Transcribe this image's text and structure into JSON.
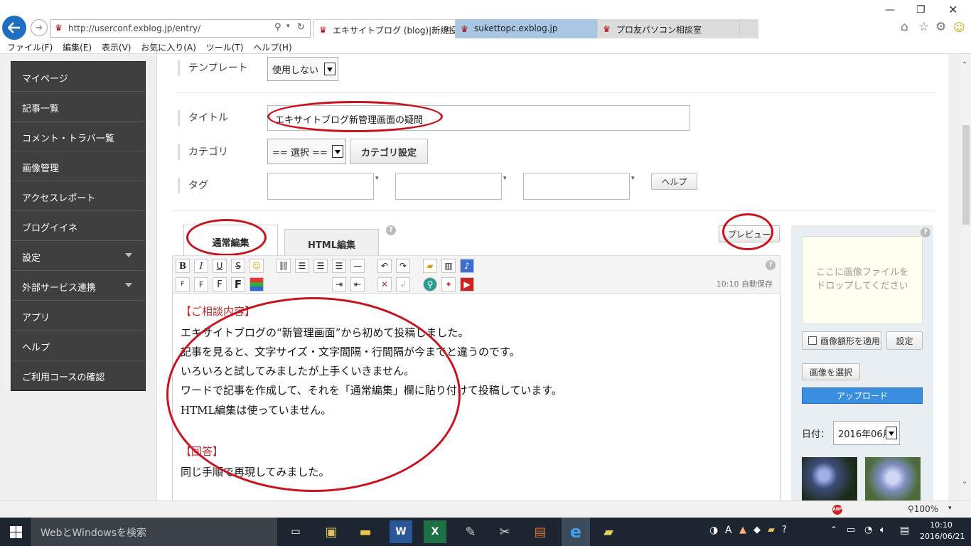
{
  "browser": {
    "url": "http://userconf.exblog.jp/entry/",
    "tabs": [
      {
        "label": "エキサイトブログ (blog)|新規投...",
        "active": true
      },
      {
        "label": "sukettopc.exblog.jp",
        "active": false
      },
      {
        "label": "プロ友パソコン相談室",
        "active": false
      }
    ],
    "tab_close": "×",
    "menu": [
      "ファイル(F)",
      "編集(E)",
      "表示(V)",
      "お気に入り(A)",
      "ツール(T)",
      "ヘルプ(H)"
    ],
    "zoom": "100%"
  },
  "sidebar": {
    "items": [
      {
        "label": "マイページ"
      },
      {
        "label": "記事一覧"
      },
      {
        "label": "コメント・トラバ一覧"
      },
      {
        "label": "画像管理"
      },
      {
        "label": "アクセスレポート"
      },
      {
        "label": "ブログイイネ"
      },
      {
        "label": "設定",
        "caret": true
      },
      {
        "label": "外部サービス連携",
        "caret": true
      },
      {
        "label": "アプリ"
      },
      {
        "label": "ヘルプ"
      },
      {
        "label": "ご利用コースの確認"
      }
    ]
  },
  "form": {
    "template_label": "テンプレート",
    "template_value": "使用しない",
    "title_label": "タイトル",
    "title_value": "エキサイトブログ新管理画面の疑問",
    "category_label": "カテゴリ",
    "category_value": "== 選択 ==",
    "category_settings": "カテゴリ設定",
    "tag_label": "タグ",
    "help_button": "ヘルプ"
  },
  "editor": {
    "tab_normal": "通常編集",
    "tab_html": "HTML編集",
    "preview_button": "プレビュー",
    "help_mark": "?",
    "autosave": "10:10 自動保存",
    "lines": {
      "l1": "【ご相談内容】",
      "l2": "エキサイトブログの“新管理画面”から初めて投稿しました。",
      "l3": "記事を見ると、文字サイズ・文字間隔・行間隔が今までと違うのです。",
      "l4": "いろいろと試してみましたが上手くいきません。",
      "l5": "ワードで記事を作成して、それを「通常編集」欄に貼り付けて投稿しています。",
      "l6": "HTML編集は使っていません。",
      "l7": "【回答】",
      "l8": "同じ手順で再現してみました。"
    }
  },
  "image_panel": {
    "drop_text_1": "ここに画像ファイルを",
    "drop_text_2": "ドロップしてください",
    "apply_frame": "画像額形を適用",
    "settings": "設定",
    "select_image": "画像を選択",
    "upload": "アップロード",
    "date_label": "日付：",
    "date_value": "2016年06月"
  },
  "taskbar": {
    "search_placeholder": "WebとWindowsを検索",
    "time": "10:10",
    "date": "2016/06/21",
    "ime": "A"
  },
  "colors": {
    "annotation": "#c8141e",
    "nav_bg": "#3f3f3f",
    "upload_bg": "#3a8ee0"
  }
}
